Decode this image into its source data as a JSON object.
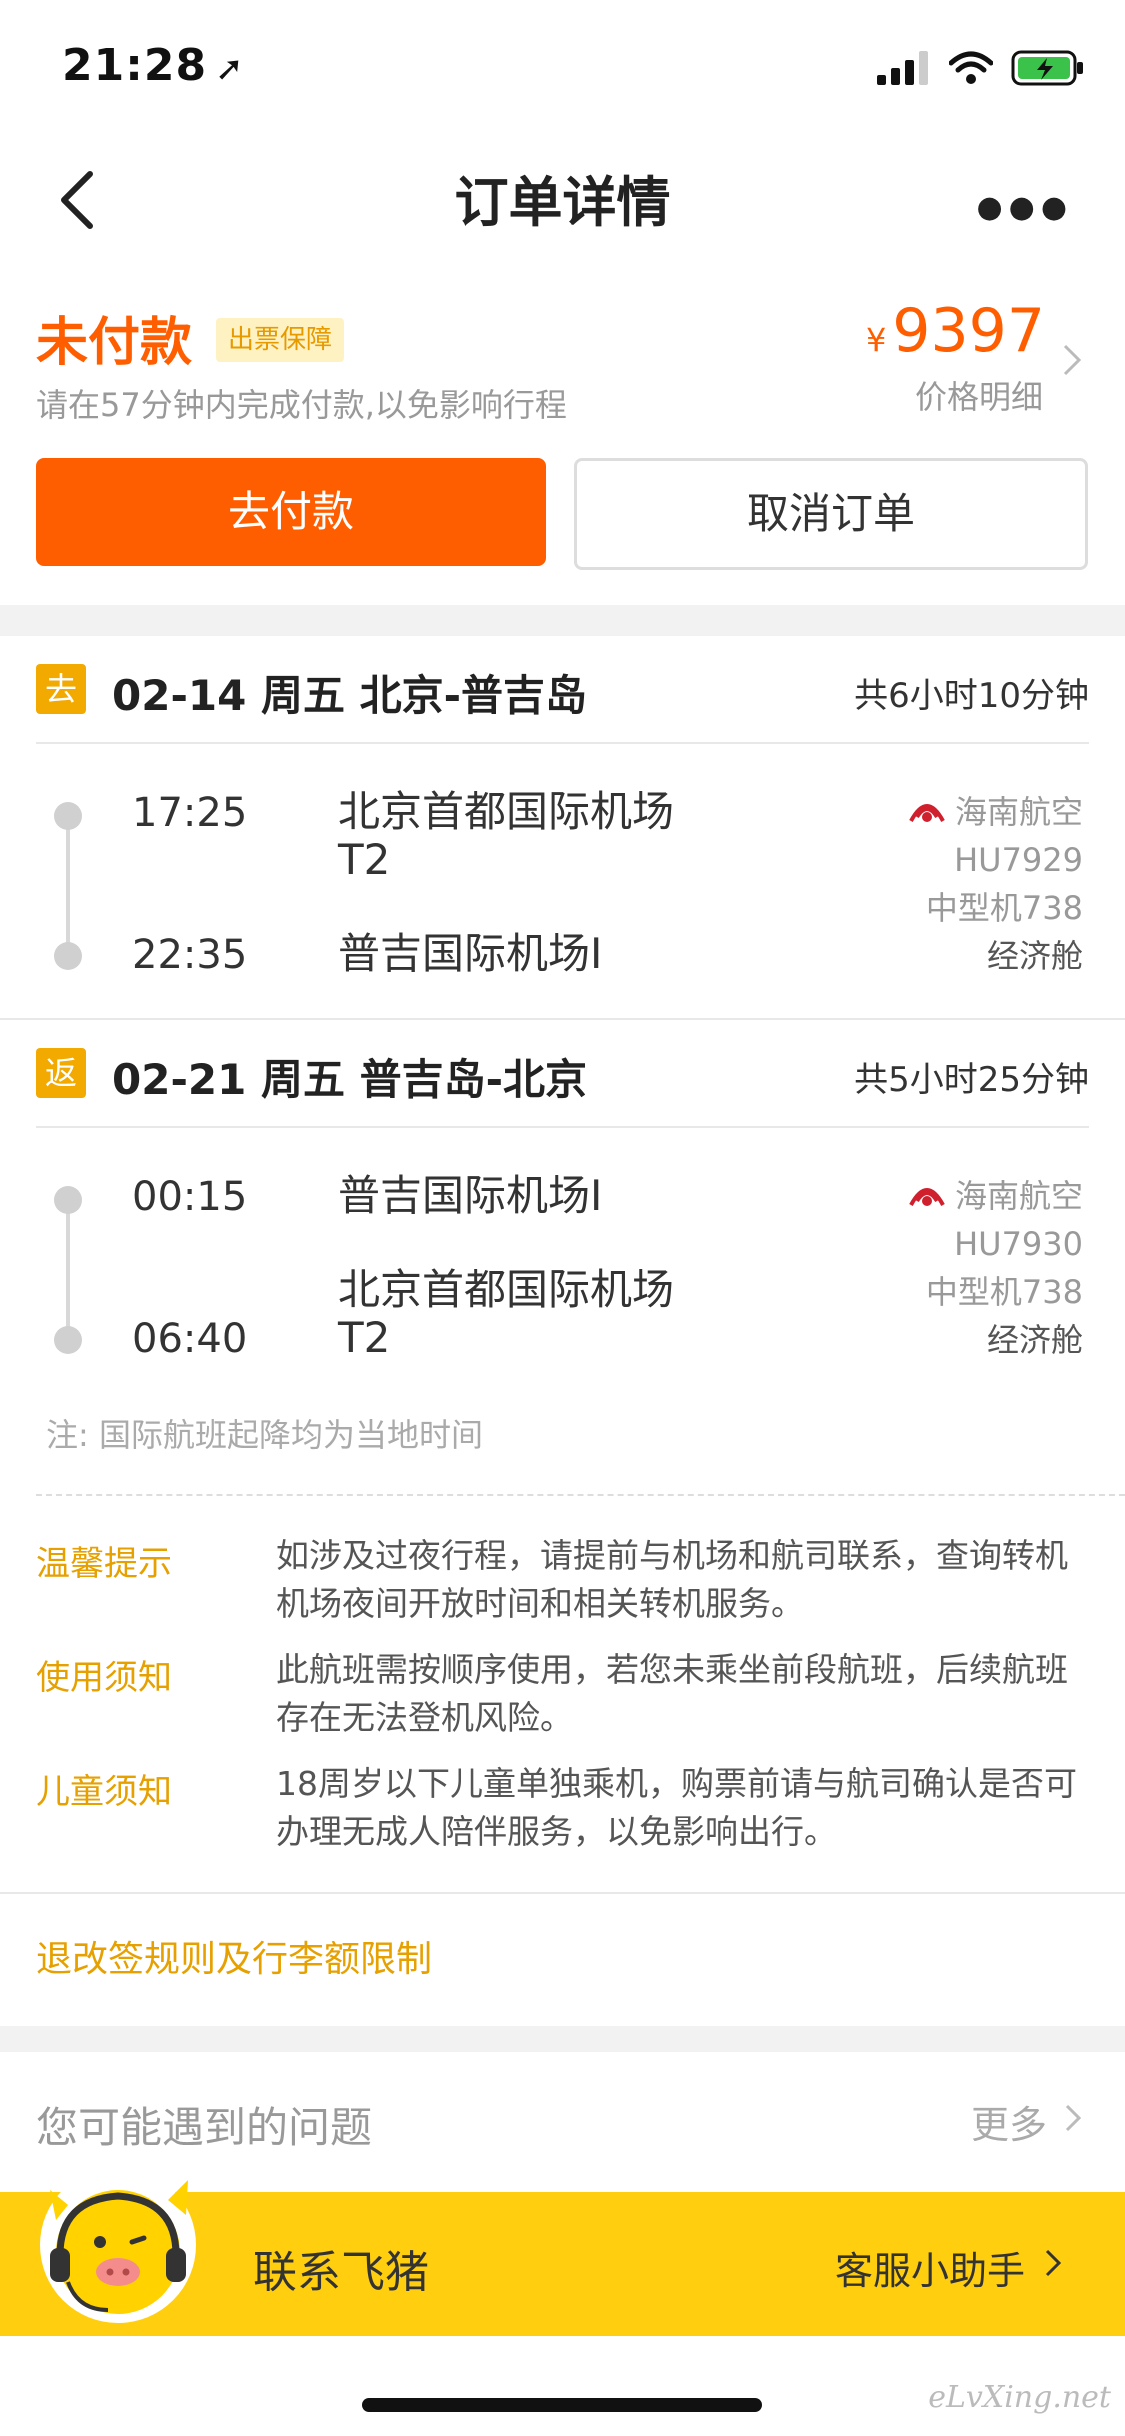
{
  "status": {
    "time": "21:28"
  },
  "nav": {
    "title": "订单详情"
  },
  "order": {
    "status": "未付款",
    "guarantee_badge": "出票保障",
    "pay_hint": "请在57分钟内完成付款,以免影响行程",
    "currency": "¥",
    "price": "9397",
    "price_detail": "价格明细",
    "pay_button": "去付款",
    "cancel_button": "取消订单"
  },
  "segments": [
    {
      "tag": "去",
      "title": "02-14 周五 北京-普吉岛",
      "duration": "共6小时10分钟",
      "dep_time": "17:25",
      "dep_airport_line1": "北京首都国际机场",
      "dep_airport_line2": "T2",
      "arr_time": "22:35",
      "arr_airport_line1": "普吉国际机场I",
      "airline": "海南航空",
      "flight_no": "HU7929",
      "aircraft": "中型机738",
      "cabin": "经济舱"
    },
    {
      "tag": "返",
      "title": "02-21 周五 普吉岛-北京",
      "duration": "共5小时25分钟",
      "dep_time": "00:15",
      "dep_airport_line1": "普吉国际机场I",
      "arr_time": "06:40",
      "arr_airport_line1": "北京首都国际机场",
      "arr_airport_line2": "T2",
      "airline": "海南航空",
      "flight_no": "HU7930",
      "aircraft": "中型机738",
      "cabin": "经济舱"
    }
  ],
  "note": "注:  国际航班起降均为当地时间",
  "tips": [
    {
      "label": "温馨提示",
      "text": "如涉及过夜行程，请提前与机场和航司联系，查询转机机场夜间开放时间和相关转机服务。"
    },
    {
      "label": "使用须知",
      "text": "此航班需按顺序使用，若您未乘坐前段航班，后续航班存在无法登机风险。"
    },
    {
      "label": "儿童须知",
      "text": "18周岁以下儿童单独乘机，购票前请与航司确认是否可办理无成人陪伴服务，以免影响出行。"
    }
  ],
  "rules_link": "退改签规则及行李额限制",
  "faq": {
    "title": "您可能遇到的问题",
    "more": "更多"
  },
  "contact": {
    "label": "联系飞猪",
    "sub": "客服小助手"
  },
  "watermark": "eLvXing.net",
  "colors": {
    "accent": "#ff5e00",
    "gold": "#e6a000",
    "contact_bg": "#ffcf0f"
  }
}
